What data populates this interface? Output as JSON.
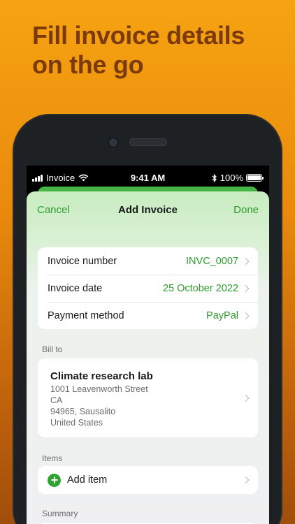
{
  "headline": {
    "line1": "Fill invoice details",
    "line2": "on the go"
  },
  "status_bar": {
    "carrier": "Invoice",
    "time": "9:41 AM",
    "battery": "100%",
    "icons": [
      "signal-icon",
      "wifi-icon",
      "bluetooth-icon",
      "battery-icon"
    ]
  },
  "nav": {
    "cancel_label": "Cancel",
    "title": "Add Invoice",
    "done_label": "Done"
  },
  "details": [
    {
      "label": "Invoice number",
      "value": "INVC_0007"
    },
    {
      "label": "Invoice date",
      "value": "25 October 2022"
    },
    {
      "label": "Payment method",
      "value": "PayPal"
    }
  ],
  "bill_to": {
    "section_label": "Bill to",
    "name": "Climate research lab",
    "address_line1": "1001  Leavenworth Street",
    "address_line2": "CA",
    "address_line3": "94965, Sausalito",
    "address_line4": "United States"
  },
  "items": {
    "section_label": "Items",
    "add_label": "Add item"
  },
  "summary": {
    "section_label": "Summary"
  },
  "colors": {
    "accent": "#2e9a2e",
    "background_top": "#f6a312",
    "headline": "#7a3a0c"
  }
}
